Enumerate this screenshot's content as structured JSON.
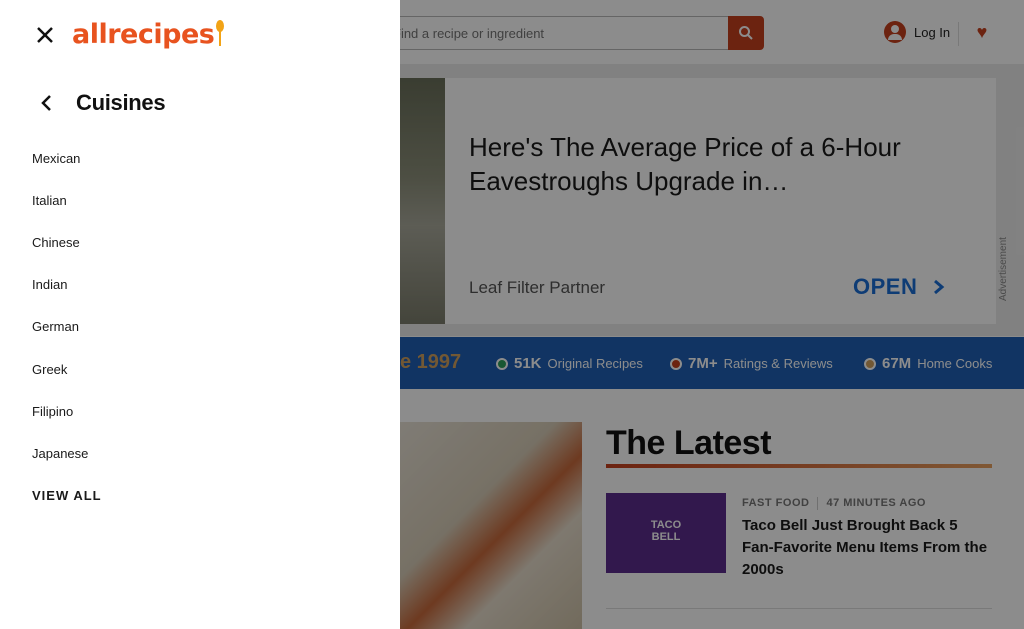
{
  "header": {
    "search_placeholder": "Find a recipe or ingredient",
    "login_label": "Log In"
  },
  "ad": {
    "headline": "Here's The Average Price of a 6-Hour Eavestroughs Upgrade in…",
    "sponsor": "Leaf Filter Partner",
    "cta": "OPEN",
    "label": "Advertisement"
  },
  "stats": {
    "since": "e 1997",
    "items": [
      {
        "value": "51K",
        "label": "Original Recipes",
        "color": "#2e9e5b"
      },
      {
        "value": "7M+",
        "label": "Ratings & Reviews",
        "color": "#c5401e"
      },
      {
        "value": "67M",
        "label": "Home Cooks",
        "color": "#d0a060"
      }
    ]
  },
  "latest": {
    "title": "The Latest",
    "article": {
      "category": "FAST FOOD",
      "time": "47 MINUTES AGO",
      "title": "Taco Bell Just Brought Back 5 Fan-Favorite Menu Items From the 2000s",
      "thumb_text": "TACO BELL"
    }
  },
  "drawer": {
    "logo_text": "allrecipes",
    "section_title": "Cuisines",
    "items": [
      {
        "label": "Mexican"
      },
      {
        "label": "Italian"
      },
      {
        "label": "Chinese"
      },
      {
        "label": "Indian"
      },
      {
        "label": "German"
      },
      {
        "label": "Greek"
      },
      {
        "label": "Filipino"
      },
      {
        "label": "Japanese"
      }
    ],
    "view_all": "VIEW ALL"
  },
  "colors": {
    "brand": "#e8531f",
    "accent": "#c5401e",
    "stats_bg": "#1f5fb4"
  },
  "icons": [
    "close-icon",
    "back-arrow-icon",
    "search-icon",
    "user-icon",
    "heart-icon",
    "chevron-right-icon"
  ]
}
